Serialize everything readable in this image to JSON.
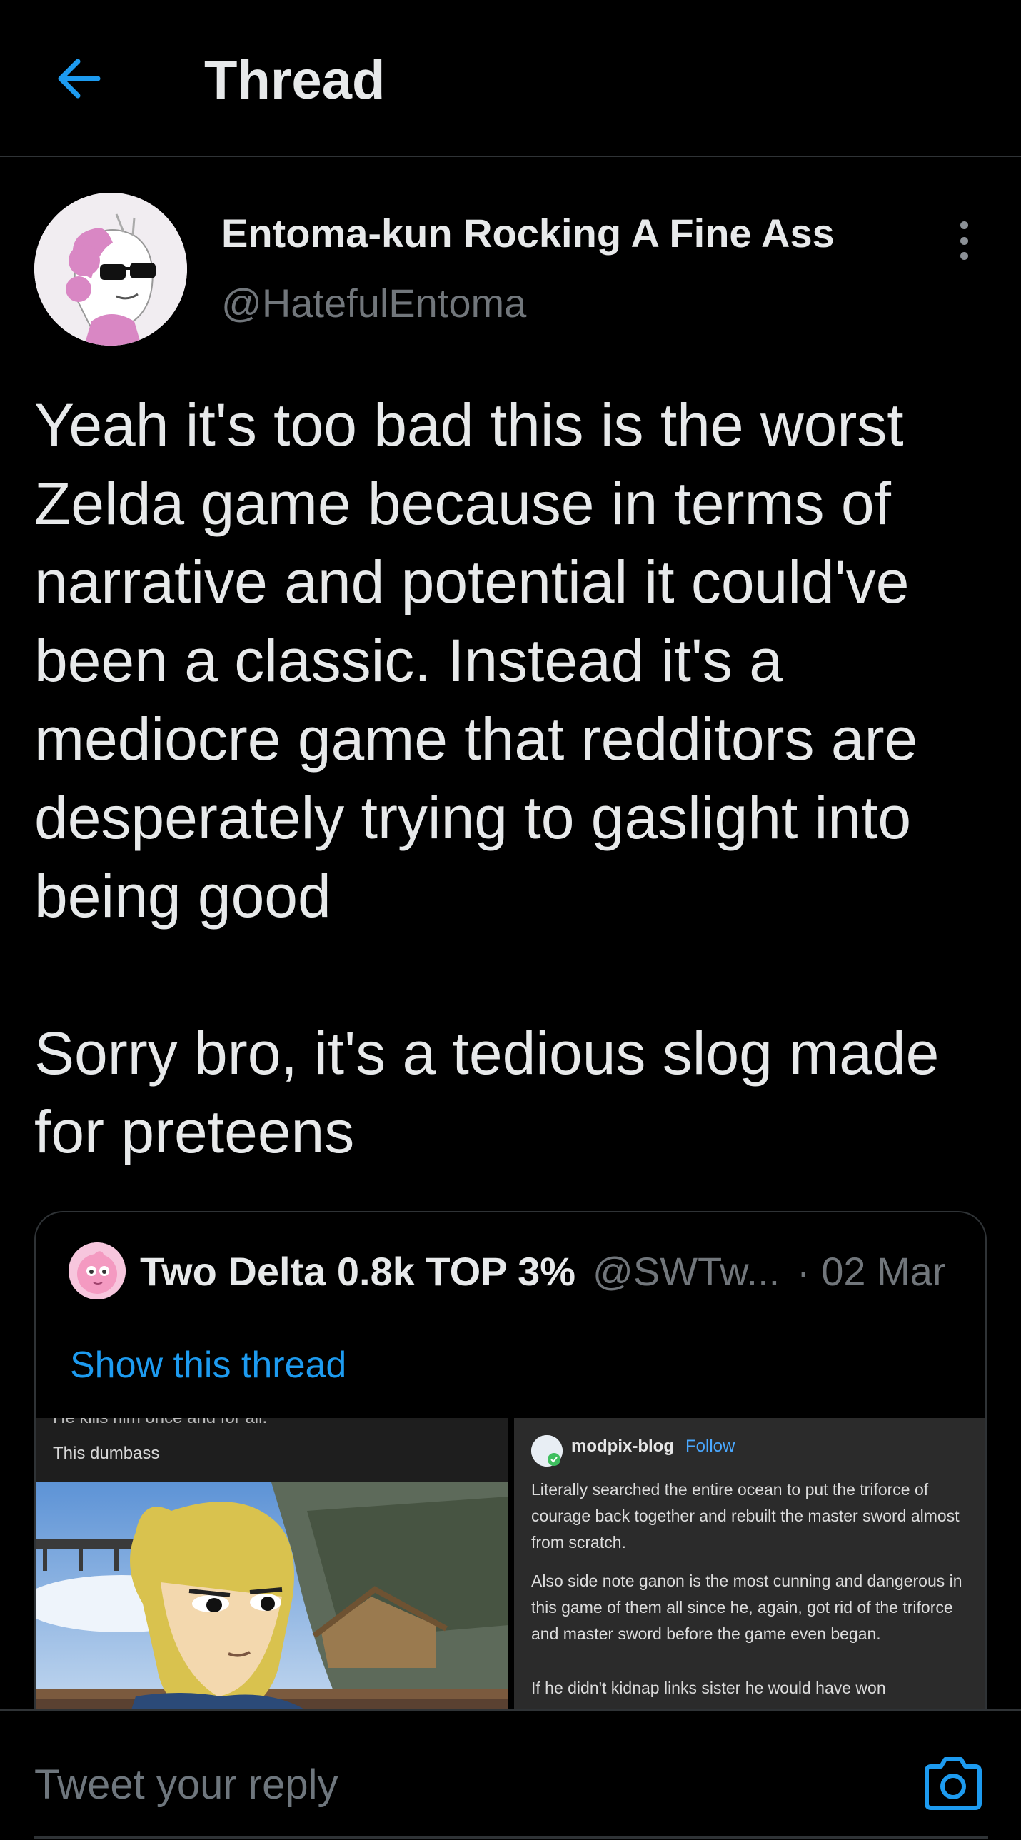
{
  "header": {
    "title": "Thread"
  },
  "tweet": {
    "author_name": "Entoma-kun Rocking A Fine Ass",
    "author_handle": "@HatefulEntoma",
    "text": "Yeah it's too bad this is the worst Zelda game because in terms of narrative and potential it could've been a classic. Instead it's a mediocre game that redditors are desperately trying to gaslight into being good\n\nSorry bro, it's a tedious slog made for preteens"
  },
  "quote": {
    "author_name": "Two Delta 0.8k TOP 3%",
    "author_handle": "@SWTw...",
    "date": "· 02 Mar",
    "show_thread": "Show this thread",
    "media_left": {
      "cut_text": "He kills him once and for all.",
      "caption": "This dumbass"
    },
    "media_right": {
      "blog_name": "modpix-blog",
      "follow_label": "Follow",
      "paragraph1": "Literally searched the entire ocean to put the triforce of courage back together and rebuilt the master sword almost from scratch.",
      "paragraph2": "Also side note ganon is the most cunning and dangerous in this game of them all since he, again, got rid of the triforce and master sword before the game even began.",
      "paragraph3": "If he didn't kidnap links sister he would have won"
    }
  },
  "reply": {
    "placeholder": "Tweet your reply"
  },
  "icons": {
    "back": "arrow-left-icon",
    "more": "more-vertical-icon",
    "camera": "camera-icon"
  },
  "colors": {
    "accent": "#1d9bf0",
    "background": "#000000",
    "secondary_text": "#71767b"
  }
}
